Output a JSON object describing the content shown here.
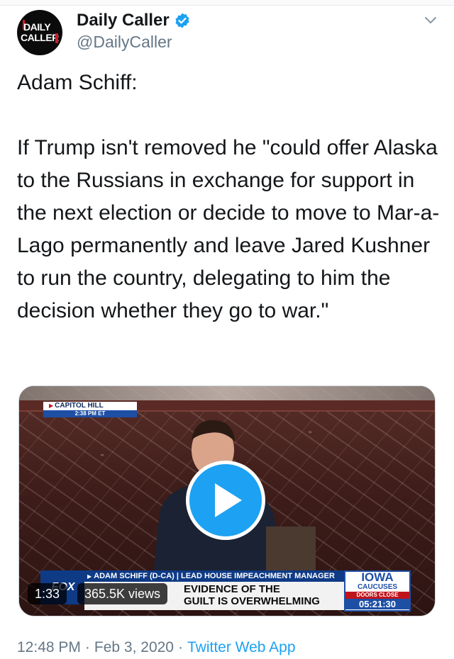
{
  "tweet": {
    "author": {
      "display_name": "Daily Caller",
      "handle": "@DailyCaller",
      "avatar_text_line1": "DAILY",
      "avatar_text_line2": "CALLER",
      "verified": true
    },
    "text": "Adam Schiff:\n\nIf Trump isn't removed he \"could offer Alaska to the Russians in exchange for support in the next election or decide to move to Mar-a-Lago permanently and leave Jared Kushner to run the country, delegating to him the decision whether they go to war.\"",
    "media": {
      "location_bug": "CAPITOL HILL",
      "location_time": "2:38 PM ET",
      "network_logo": "FOX",
      "lower_third_banner": "ADAM SCHIFF (D-CA) | LEAD HOUSE IMPEACHMENT MANAGER",
      "lower_third_line1": "EVIDENCE OF THE",
      "lower_third_line2": "GUILT IS OVERWHELMING",
      "iowa_title": "IOWA",
      "iowa_sub": "CAUCUSES",
      "iowa_doors": "DOORS CLOSE",
      "iowa_clock": "05:21:30",
      "duration": "1:33",
      "views": "365.5K views"
    },
    "timestamp": {
      "time": "12:48 PM",
      "date": "Feb 3, 2020",
      "source": "Twitter Web App"
    },
    "colors": {
      "accent": "#1da1f2",
      "text": "#14171a",
      "secondary": "#657786"
    },
    "icons": {
      "verified": "verified-badge-icon",
      "menu": "chevron-down-icon",
      "play": "play-icon"
    }
  }
}
